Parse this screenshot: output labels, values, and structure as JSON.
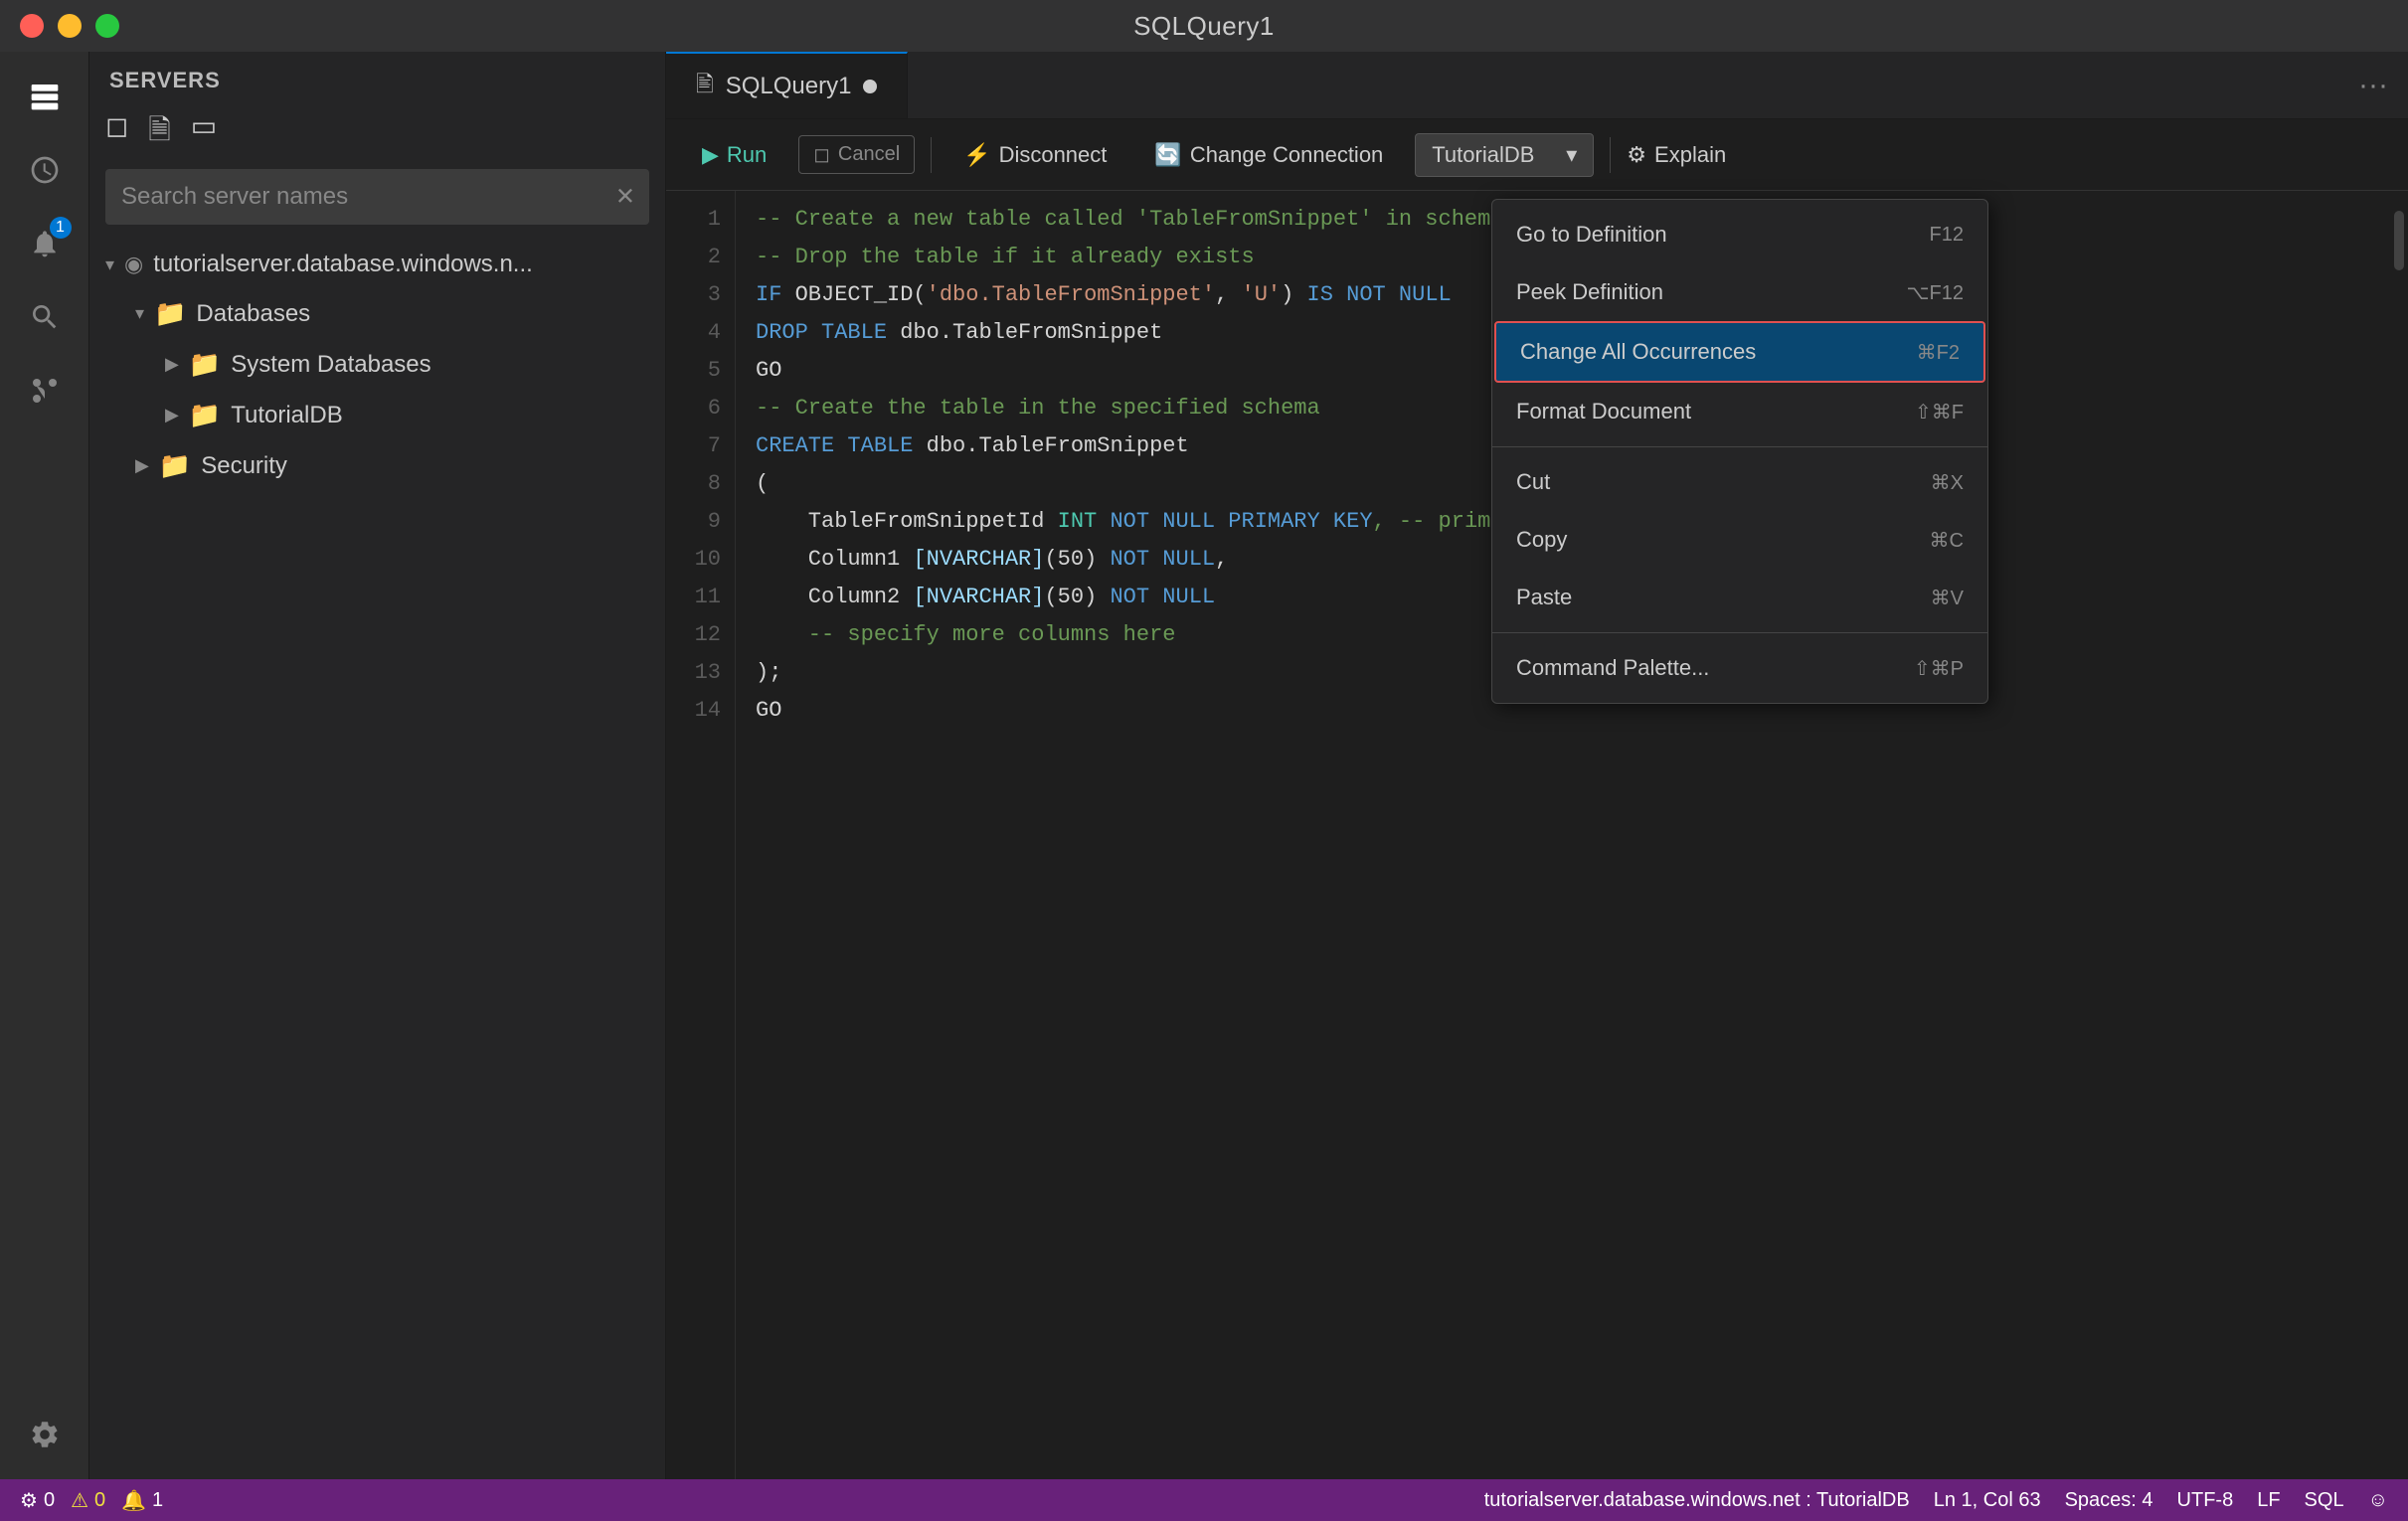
{
  "titlebar": {
    "title": "SQLQuery1"
  },
  "sidebar": {
    "header": "SERVERS",
    "search_placeholder": "Search server names",
    "tree": [
      {
        "id": "server",
        "label": "tutorialserver.database.windows.n...",
        "indent": 0,
        "type": "server",
        "expanded": true
      },
      {
        "id": "databases",
        "label": "Databases",
        "indent": 1,
        "type": "folder",
        "expanded": true
      },
      {
        "id": "system-databases",
        "label": "System Databases",
        "indent": 2,
        "type": "folder",
        "expanded": false
      },
      {
        "id": "tutorialdb",
        "label": "TutorialDB",
        "indent": 2,
        "type": "folder",
        "expanded": false
      },
      {
        "id": "security",
        "label": "Security",
        "indent": 1,
        "type": "folder",
        "expanded": false
      }
    ]
  },
  "tab": {
    "label": "SQLQuery1",
    "modified": true
  },
  "toolbar": {
    "run_label": "Run",
    "cancel_label": "Cancel",
    "disconnect_label": "Disconnect",
    "change_connection_label": "Change Connection",
    "database": "TutorialDB",
    "explain_label": "Explain"
  },
  "code_lines": [
    {
      "num": 1,
      "tokens": [
        {
          "text": "-- Create a new table called 'TableFromSnippet' in schema 'dbo'",
          "class": "comment"
        }
      ]
    },
    {
      "num": 2,
      "tokens": [
        {
          "text": "-- Drop the table if it already exists",
          "class": "comment"
        }
      ]
    },
    {
      "num": 3,
      "tokens": [
        {
          "text": "IF ",
          "class": "keyword"
        },
        {
          "text": "OBJECT_ID(",
          "class": "plain"
        },
        {
          "text": "'dbo.TableFromSnippet'",
          "class": "string"
        },
        {
          "text": ", ",
          "class": "plain"
        },
        {
          "text": "'U'",
          "class": "string"
        },
        {
          "text": ") ",
          "class": "plain"
        },
        {
          "text": "IS NOT NULL",
          "class": "keyword"
        }
      ]
    },
    {
      "num": 4,
      "tokens": [
        {
          "text": "DROP TABLE ",
          "class": "keyword"
        },
        {
          "text": "dbo.TableFromSnippet",
          "class": "plain"
        }
      ]
    },
    {
      "num": 5,
      "tokens": [
        {
          "text": "GO",
          "class": "plain"
        }
      ]
    },
    {
      "num": 6,
      "tokens": [
        {
          "text": "-- Create the table in the specified schema",
          "class": "comment"
        }
      ]
    },
    {
      "num": 7,
      "tokens": [
        {
          "text": "CREATE TABLE ",
          "class": "keyword"
        },
        {
          "text": "dbo.TableFromSnippet",
          "class": "plain"
        }
      ]
    },
    {
      "num": 8,
      "tokens": [
        {
          "text": "(",
          "class": "plain"
        }
      ]
    },
    {
      "num": 9,
      "tokens": [
        {
          "text": "    TableFromSnippetId ",
          "class": "plain"
        },
        {
          "text": "INT ",
          "class": "type-kw"
        },
        {
          "text": "NOT NULL ",
          "class": "keyword"
        },
        {
          "text": "PRIMARY KEY",
          "class": "keyword"
        },
        {
          "text": ", -- primary key",
          "class": "comment"
        }
      ]
    },
    {
      "num": 10,
      "tokens": [
        {
          "text": "    Column1 ",
          "class": "plain"
        },
        {
          "text": "[NVARCHAR]",
          "class": "identifier"
        },
        {
          "text": "(50) ",
          "class": "plain"
        },
        {
          "text": "NOT NULL",
          "class": "keyword"
        },
        {
          "text": ",",
          "class": "plain"
        }
      ]
    },
    {
      "num": 11,
      "tokens": [
        {
          "text": "    Column2 ",
          "class": "plain"
        },
        {
          "text": "[NVARCHAR]",
          "class": "identifier"
        },
        {
          "text": "(50) ",
          "class": "plain"
        },
        {
          "text": "NOT NULL",
          "class": "keyword"
        }
      ]
    },
    {
      "num": 12,
      "tokens": [
        {
          "text": "    -- specify more columns here",
          "class": "comment"
        }
      ]
    },
    {
      "num": 13,
      "tokens": [
        {
          "text": ");",
          "class": "plain"
        }
      ]
    },
    {
      "num": 14,
      "tokens": [
        {
          "text": "GO",
          "class": "plain"
        }
      ]
    }
  ],
  "context_menu": {
    "items": [
      {
        "label": "Go to Definition",
        "shortcut": "F12",
        "highlighted": false,
        "separator_after": false
      },
      {
        "label": "Peek Definition",
        "shortcut": "⌥F12",
        "highlighted": false,
        "separator_after": false
      },
      {
        "label": "Change All Occurrences",
        "shortcut": "⌘F2",
        "highlighted": true,
        "separator_after": false
      },
      {
        "label": "Format Document",
        "shortcut": "⇧⌘F",
        "highlighted": false,
        "separator_after": true
      },
      {
        "label": "Cut",
        "shortcut": "⌘X",
        "highlighted": false,
        "separator_after": false
      },
      {
        "label": "Copy",
        "shortcut": "⌘C",
        "highlighted": false,
        "separator_after": false
      },
      {
        "label": "Paste",
        "shortcut": "⌘V",
        "highlighted": false,
        "separator_after": true
      },
      {
        "label": "Command Palette...",
        "shortcut": "⇧⌘P",
        "highlighted": false,
        "separator_after": false
      }
    ]
  },
  "status_bar": {
    "errors": "0",
    "warnings": "0",
    "notifications": "1",
    "server": "tutorialserver.database.windows.net : TutorialDB",
    "position": "Ln 1, Col 63",
    "spaces": "Spaces: 4",
    "encoding": "UTF-8",
    "line_ending": "LF",
    "language": "SQL"
  }
}
